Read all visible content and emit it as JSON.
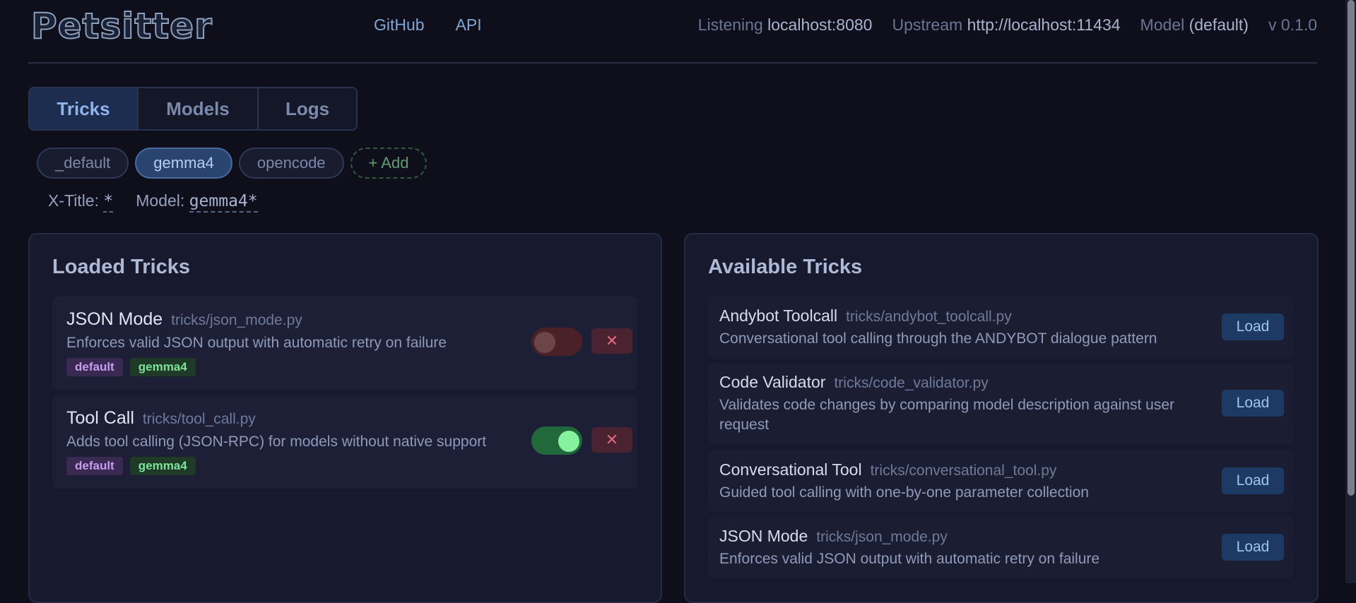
{
  "header": {
    "logo": "Petsitter",
    "nav": [
      "GitHub",
      "API"
    ],
    "status": {
      "listening_label": "Listening",
      "listening_value": "localhost:8080",
      "upstream_label": "Upstream",
      "upstream_value": "http://localhost:11434",
      "model_label": "Model",
      "model_value": "(default)",
      "version": "v 0.1.0"
    }
  },
  "tabs": [
    "Tricks",
    "Models",
    "Logs"
  ],
  "active_tab": "Tricks",
  "profiles": [
    "_default",
    "gemma4",
    "opencode"
  ],
  "active_profile": "gemma4",
  "add_label": "+ Add",
  "filter": {
    "xtitle_label": "X-Title:",
    "xtitle_value": "*",
    "model_label": "Model:",
    "model_value": "gemma4*"
  },
  "loaded": {
    "title": "Loaded Tricks",
    "items": [
      {
        "name": "JSON Mode",
        "path": "tricks/json_mode.py",
        "desc": "Enforces valid JSON output with automatic retry on failure",
        "tags": [
          "default",
          "gemma4"
        ],
        "enabled": false,
        "remove": "✕"
      },
      {
        "name": "Tool Call",
        "path": "tricks/tool_call.py",
        "desc": "Adds tool calling (JSON-RPC) for models without native support",
        "tags": [
          "default",
          "gemma4"
        ],
        "enabled": true,
        "remove": "✕"
      }
    ]
  },
  "available": {
    "title": "Available Tricks",
    "load_label": "Load",
    "items": [
      {
        "name": "Andybot Toolcall",
        "path": "tricks/andybot_toolcall.py",
        "desc": "Conversational tool calling through the ANDYBOT dialogue pattern"
      },
      {
        "name": "Code Validator",
        "path": "tricks/code_validator.py",
        "desc": "Validates code changes by comparing model description against user request"
      },
      {
        "name": "Conversational Tool",
        "path": "tricks/conversational_tool.py",
        "desc": "Guided tool calling with one-by-one parameter collection"
      },
      {
        "name": "JSON Mode",
        "path": "tricks/json_mode.py",
        "desc": "Enforces valid JSON output with automatic retry on failure"
      }
    ]
  },
  "colors": {
    "background": "#0f0f1c",
    "accent": "#7fa6d6",
    "toggle_on": "#21693a",
    "toggle_off": "#4a2126",
    "remove": "#4b2230"
  }
}
